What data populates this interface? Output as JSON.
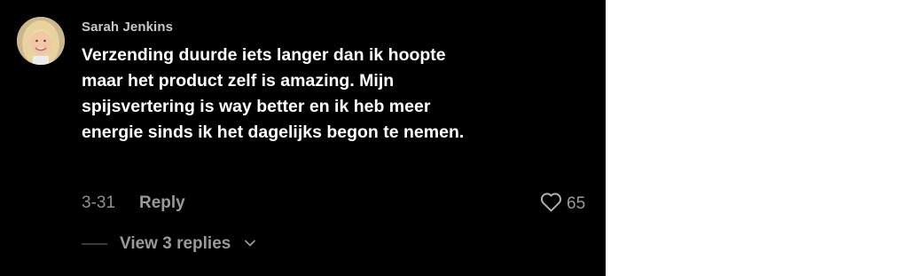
{
  "comment": {
    "username": "Sarah Jenkins",
    "text": "Verzending duurde iets langer dan ik hoopte maar het product zelf is amazing. Mijn spijsvertering is way better en ik heb meer energie sinds ik het dagelijks begon te nemen.",
    "date": "3-31",
    "reply_label": "Reply",
    "like_count": "65",
    "like_icon": "heart-outline-icon",
    "view_replies_label": "View 3 replies",
    "view_replies_icon": "chevron-down-icon"
  },
  "colors": {
    "background": "#000000",
    "text": "#ffffff",
    "muted": "#9a9a9a"
  }
}
